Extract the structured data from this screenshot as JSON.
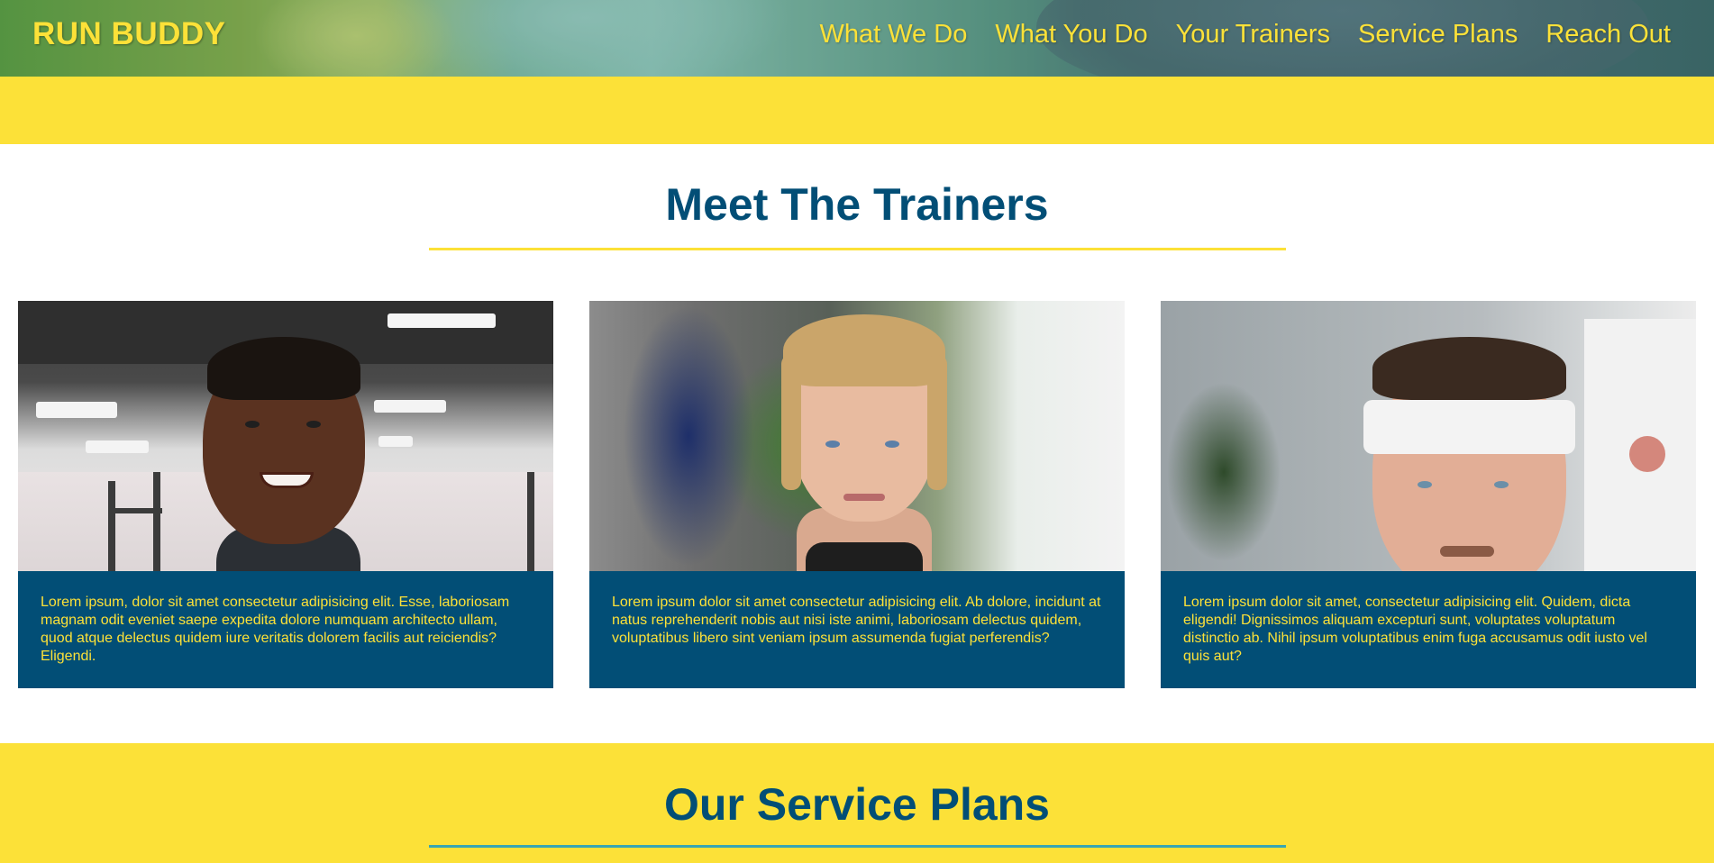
{
  "header": {
    "logo": "RUN BUDDY",
    "nav": [
      {
        "label": "What We Do"
      },
      {
        "label": "What You Do"
      },
      {
        "label": "Your Trainers"
      },
      {
        "label": "Service Plans"
      },
      {
        "label": "Reach Out"
      }
    ]
  },
  "trainers": {
    "title": "Meet The Trainers",
    "cards": [
      {
        "text": "Lorem ipsum, dolor sit amet consectetur adipisicing elit. Esse, laboriosam magnam odit eveniet saepe expedita dolore numquam architecto ullam, quod atque delectus quidem iure veritatis dolorem facilis aut reiciendis? Eligendi."
      },
      {
        "text": "Lorem ipsum dolor sit amet consectetur adipisicing elit. Ab dolore, incidunt at natus reprehenderit nobis aut nisi iste animi, laboriosam delectus quidem, voluptatibus libero sint veniam ipsum assumenda fugiat perferendis?"
      },
      {
        "text": "Lorem ipsum dolor sit amet, consectetur adipisicing elit. Quidem, dicta eligendi! Dignissimos aliquam excepturi sunt, voluptates voluptatum distinctio ab. Nihil ipsum voluptatibus enim fuga accusamus odit iusto vel quis aut?"
      }
    ]
  },
  "plans": {
    "title": "Our Service Plans"
  },
  "colors": {
    "brand_yellow": "#fce138",
    "brand_blue": "#024e76",
    "accent_teal": "#39a6b2"
  }
}
